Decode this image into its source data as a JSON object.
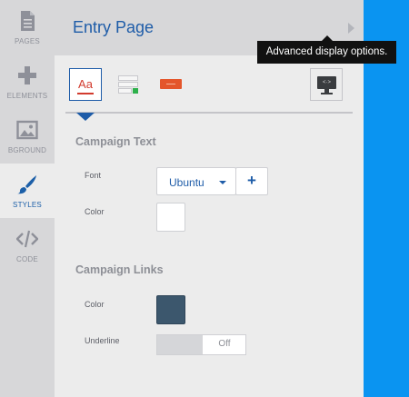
{
  "sidebar": {
    "items": [
      {
        "label": "PAGES",
        "icon": "page-icon",
        "active": false
      },
      {
        "label": "ELEMENTS",
        "icon": "plus-icon",
        "active": false
      },
      {
        "label": "BGROUND",
        "icon": "image-icon",
        "active": false
      },
      {
        "label": "STYLES",
        "icon": "brush-icon",
        "active": true
      },
      {
        "label": "CODE",
        "icon": "code-icon",
        "active": false
      }
    ]
  },
  "header": {
    "title": "Entry Page"
  },
  "tooltip": {
    "text": "Advanced display options."
  },
  "tools": {
    "text_icon_glyph": "Aa",
    "display_icon_glyph": "<·>"
  },
  "campaign_text": {
    "title": "Campaign Text",
    "font_label": "Font",
    "font_value": "Ubuntu",
    "font_add": "+",
    "color_label": "Color",
    "color_value": "#ffffff"
  },
  "campaign_links": {
    "title": "Campaign Links",
    "color_label": "Color",
    "color_value": "#3c576d",
    "underline_label": "Underline",
    "underline_value": "Off"
  },
  "colors": {
    "accent": "#1e5ca8",
    "preview_bg": "#0a94f1"
  }
}
